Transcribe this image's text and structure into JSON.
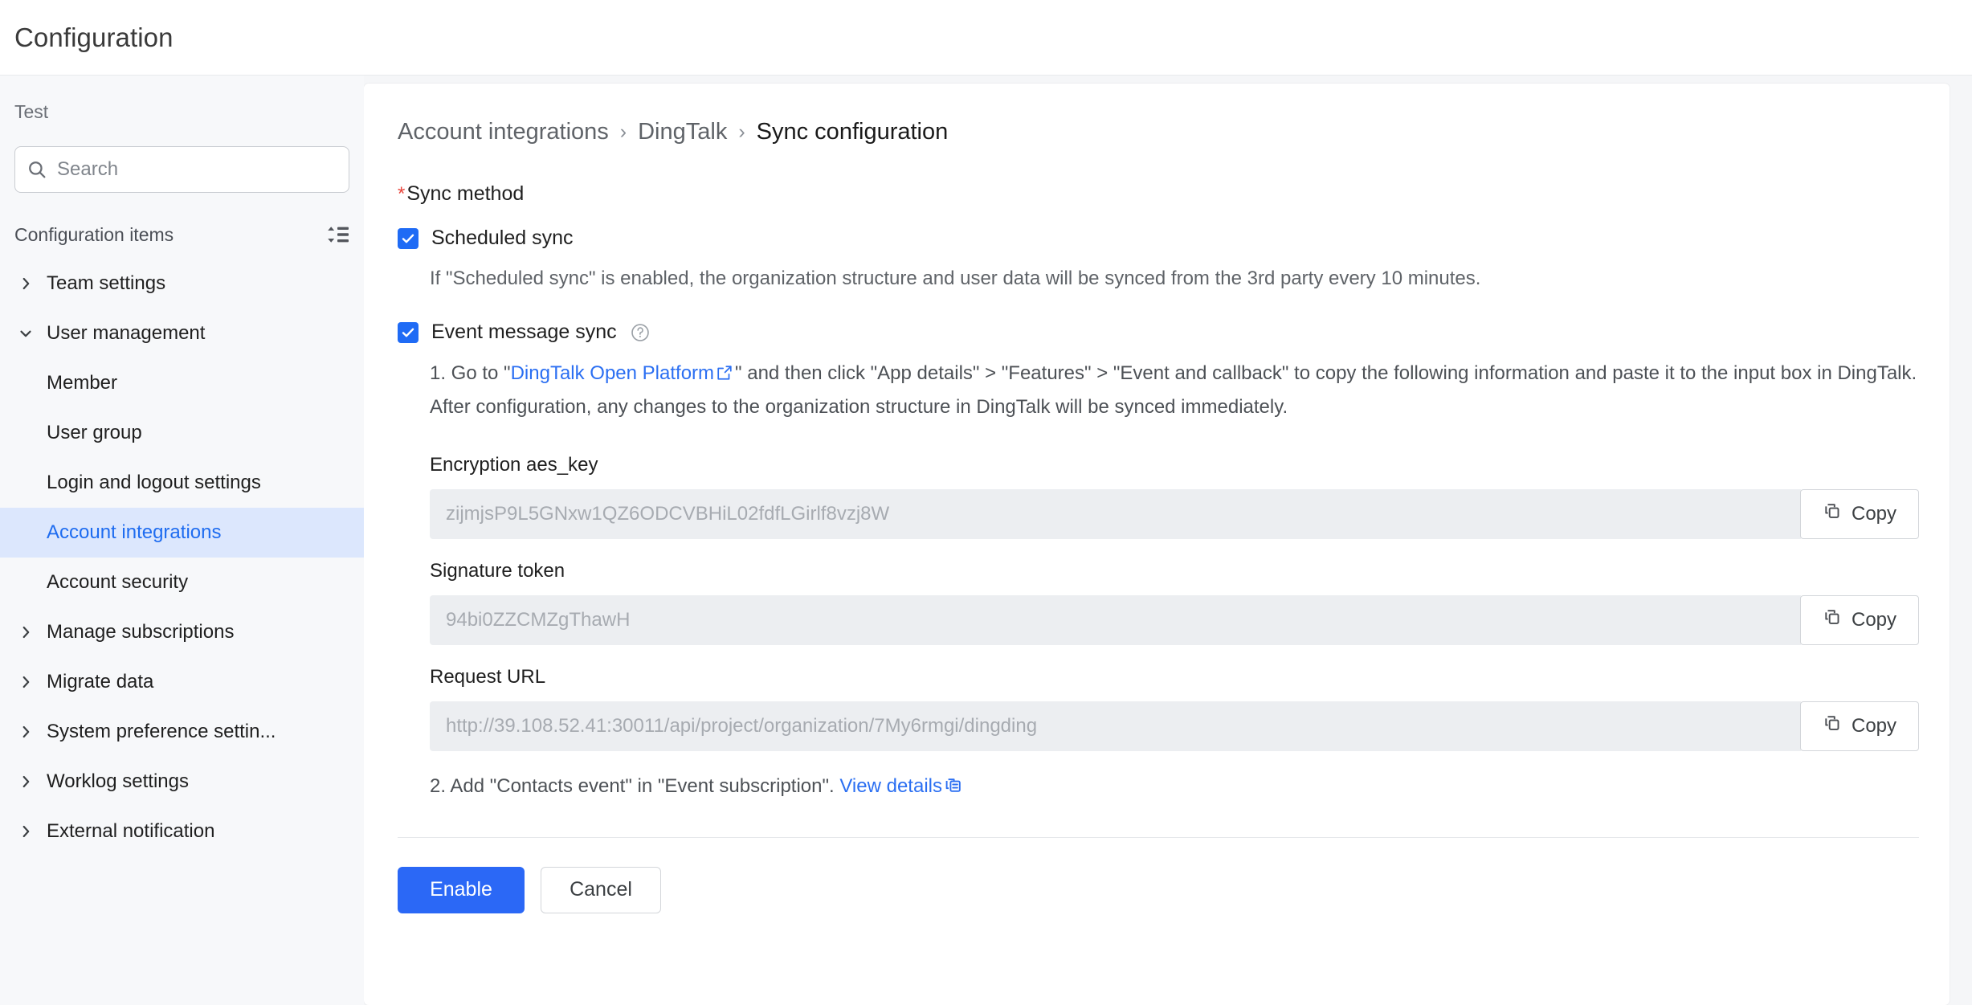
{
  "header": {
    "title": "Configuration"
  },
  "sidebar": {
    "org_name": "Test",
    "search": {
      "placeholder": "Search",
      "value": "",
      "icon": "search-icon"
    },
    "section_title": "Configuration items",
    "collapse_icon": "expand-collapse-icon",
    "items": [
      {
        "label": "Team settings",
        "level": "parent",
        "expanded": false,
        "active": false
      },
      {
        "label": "User management",
        "level": "parent",
        "expanded": true,
        "active": false
      },
      {
        "label": "Member",
        "level": "child",
        "active": false
      },
      {
        "label": "User group",
        "level": "child",
        "active": false
      },
      {
        "label": "Login and logout settings",
        "level": "child",
        "active": false
      },
      {
        "label": "Account integrations",
        "level": "child",
        "active": true
      },
      {
        "label": "Account security",
        "level": "child",
        "active": false
      },
      {
        "label": "Manage subscriptions",
        "level": "parent",
        "expanded": false,
        "active": false
      },
      {
        "label": "Migrate data",
        "level": "parent",
        "expanded": false,
        "active": false
      },
      {
        "label": "System preference settin...",
        "level": "parent",
        "expanded": false,
        "active": false
      },
      {
        "label": "Worklog settings",
        "level": "parent",
        "expanded": false,
        "active": false
      },
      {
        "label": "External notification",
        "level": "parent",
        "expanded": false,
        "active": false
      }
    ]
  },
  "main": {
    "breadcrumb": {
      "items": [
        "Account integrations",
        "DingTalk",
        "Sync configuration"
      ],
      "separator": "›"
    },
    "sync_method": {
      "required_marker": "*",
      "label": "Sync method"
    },
    "scheduled_sync": {
      "label": "Scheduled sync",
      "checked": true,
      "hint": "If \"Scheduled sync\" is enabled, the organization structure and user data will be synced from the 3rd party every 10 minutes."
    },
    "event_message_sync": {
      "label": "Event message sync",
      "checked": true,
      "help_icon": "question-mark-icon",
      "step1": {
        "prefix": "1. Go to \"",
        "link_text": "DingTalk Open Platform",
        "link_icon": "external-link-icon",
        "suffix": "\" and then click \"App details\" > \"Features\" > \"Event and callback\" to copy the following information and paste it to the input box in DingTalk. After configuration, any changes to the organization structure in DingTalk will be synced immediately."
      },
      "fields": [
        {
          "label": "Encryption aes_key",
          "value": "zijmjsP9L5GNxw1QZ6ODCVBHiL02fdfLGirlf8vzj8W",
          "copy_label": "Copy",
          "copy_icon": "copy-icon"
        },
        {
          "label": "Signature token",
          "value": "94bi0ZZCMZgThawH",
          "copy_label": "Copy",
          "copy_icon": "copy-icon"
        },
        {
          "label": "Request URL",
          "value": "http://39.108.52.41:30011/api/project/organization/7My6rmgi/dingding",
          "copy_label": "Copy",
          "copy_icon": "copy-icon"
        }
      ],
      "step2": {
        "prefix": "2. Add \"Contacts event\" in \"Event subscription\". ",
        "link_text": "View details",
        "link_icon": "document-link-icon"
      }
    },
    "actions": {
      "primary_label": "Enable",
      "secondary_label": "Cancel"
    }
  },
  "colors": {
    "accent": "#2b68f6",
    "link": "#2b6ff2",
    "active_nav_bg": "#dce7fd",
    "active_nav_text": "#1e6cf0",
    "required_star": "#e8453c",
    "input_bg": "#eceef1"
  }
}
